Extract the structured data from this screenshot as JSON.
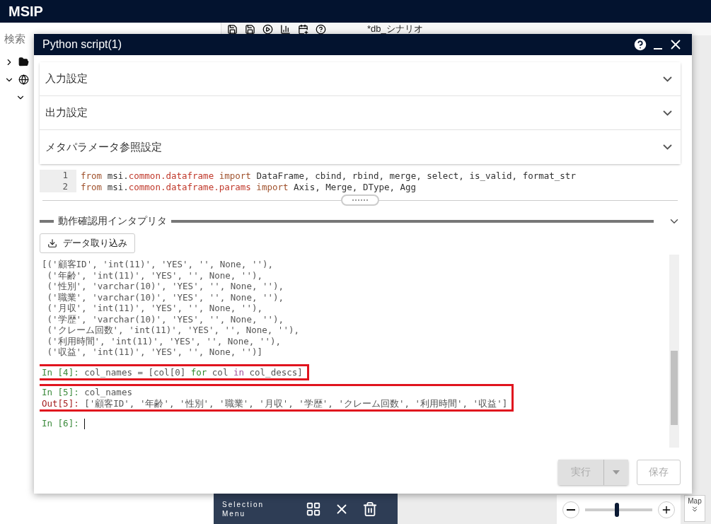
{
  "app": {
    "title": "MSIP"
  },
  "sidebar": {
    "search_label": "検索",
    "tree": [
      {
        "expanded": false
      },
      {
        "expanded": true,
        "children": [
          {
            "expanded": true
          }
        ]
      }
    ]
  },
  "toolbar": {
    "tab": {
      "label": "*db_シナリオ"
    }
  },
  "dialog": {
    "title": "Python script(1)",
    "sections": [
      {
        "label": "入力設定",
        "expanded": false
      },
      {
        "label": "出力設定",
        "expanded": false
      },
      {
        "label": "メタパラメータ参照設定",
        "expanded": false
      }
    ],
    "editor": {
      "lines": [
        {
          "number": "1",
          "tokens": [
            {
              "kind": "keyword",
              "text": "from"
            },
            {
              "kind": "plain",
              "text": " msi."
            },
            {
              "kind": "module",
              "text": "common.dataframe"
            },
            {
              "kind": "keyword",
              "text": " import"
            },
            {
              "kind": "plain",
              "text": " DataFrame, cbind, rbind, merge, select, is_valid, format_str"
            }
          ]
        },
        {
          "number": "2",
          "tokens": [
            {
              "kind": "keyword",
              "text": "from"
            },
            {
              "kind": "plain",
              "text": " msi."
            },
            {
              "kind": "module",
              "text": "common.dataframe.params"
            },
            {
              "kind": "keyword",
              "text": " import"
            },
            {
              "kind": "plain",
              "text": " Axis, Merge, DType, Agg"
            }
          ]
        }
      ]
    },
    "interpreter": {
      "title": "動作確認用インタプリタ",
      "import_button": "データ取り込み",
      "cells": [
        {
          "highlighted": false,
          "lines": [
            {
              "kind": "output",
              "text": "[('顧客ID', 'int(11)', 'YES', '', None, ''),"
            },
            {
              "kind": "output",
              "text": " ('年齢', 'int(11)', 'YES', '', None, ''),"
            },
            {
              "kind": "output",
              "text": " ('性別', 'varchar(10)', 'YES', '', None, ''),"
            },
            {
              "kind": "output",
              "text": " ('職業', 'varchar(10)', 'YES', '', None, ''),"
            },
            {
              "kind": "output",
              "text": " ('月収', 'int(11)', 'YES', '', None, ''),"
            },
            {
              "kind": "output",
              "text": " ('学歴', 'varchar(10)', 'YES', '', None, ''),"
            },
            {
              "kind": "output",
              "text": " ('クレーム回数', 'int(11)', 'YES', '', None, ''),"
            },
            {
              "kind": "output",
              "text": " ('利用時間', 'int(11)', 'YES', '', None, ''),"
            },
            {
              "kind": "output",
              "text": " ('収益', 'int(11)', 'YES', '', None, '')]"
            }
          ]
        },
        {
          "highlighted": true,
          "lines": [
            {
              "kind": "input",
              "prompt": "In [4]:",
              "cursor": false,
              "tokens": [
                {
                  "kind": "plain",
                  "text": "col_names = [col[0] "
                },
                {
                  "kind": "keyword",
                  "text": "for"
                },
                {
                  "kind": "plain",
                  "text": " col "
                },
                {
                  "kind": "operator",
                  "text": "in"
                },
                {
                  "kind": "plain",
                  "text": " col_descs]"
                }
              ]
            }
          ]
        },
        {
          "highlighted": true,
          "lines": [
            {
              "kind": "input",
              "prompt": "In [5]:",
              "cursor": false,
              "tokens": [
                {
                  "kind": "plain",
                  "text": "col_names"
                }
              ]
            },
            {
              "kind": "result",
              "prompt": "Out[5]:",
              "tokens": [
                {
                  "kind": "plain",
                  "text": "['顧客ID', '年齢', '性別', '職業', '月収', '学歴', 'クレーム回数', '利用時間', '収益']"
                }
              ]
            }
          ]
        },
        {
          "highlighted": false,
          "lines": [
            {
              "kind": "input",
              "prompt": "In [6]:",
              "cursor": true
            }
          ]
        }
      ]
    },
    "buttons": [
      {
        "label": "実行",
        "disabled": true,
        "dropdown": true
      },
      {
        "label": "保存",
        "disabled": true,
        "dropdown": false
      }
    ]
  },
  "selection_menu": {
    "lines": [
      "Selection",
      "Menu"
    ]
  },
  "zoom": {
    "level": 0.47,
    "map_label": "Map"
  }
}
